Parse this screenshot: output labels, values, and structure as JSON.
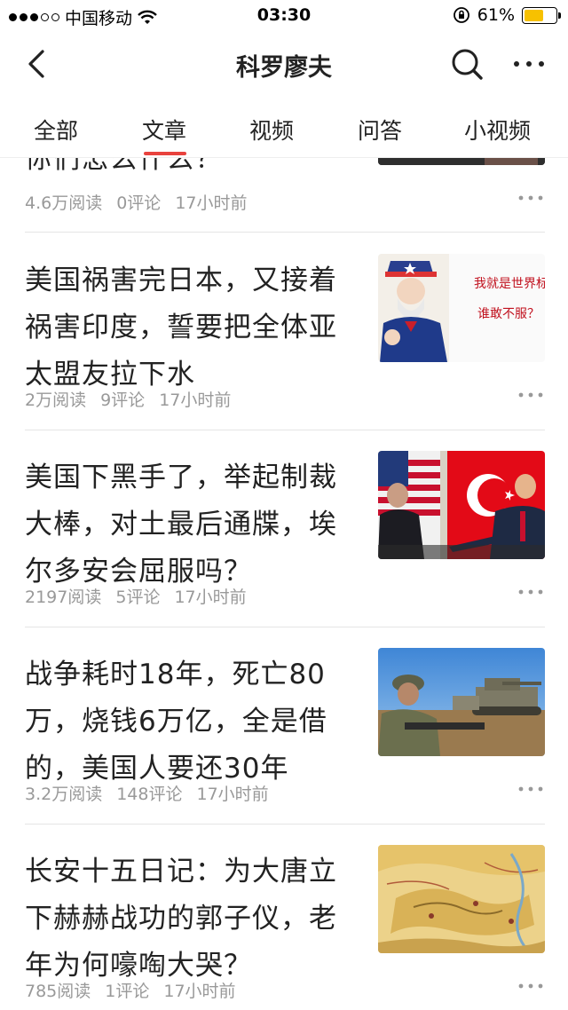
{
  "status_bar": {
    "carrier": "中国移动",
    "time": "03:30",
    "battery": "61%",
    "battery_level": 0.61,
    "icons": [
      "signal-icon",
      "wifi-icon",
      "orientation-lock-icon",
      "battery-icon"
    ]
  },
  "nav": {
    "title": "科罗廖夫",
    "icons": [
      "back-icon",
      "search-icon",
      "more-icon"
    ]
  },
  "tabs": [
    {
      "label": "全部"
    },
    {
      "label": "文章",
      "active": true
    },
    {
      "label": "视频"
    },
    {
      "label": "问答"
    },
    {
      "label": "小视频"
    }
  ],
  "colors": {
    "accent": "#e8423d",
    "meta_text": "#999999",
    "battery": "#f7c100"
  },
  "feed": {
    "partial_item": {
      "title_fragment": "你们怎么什么？",
      "reads": "4.6万阅读",
      "comments": "0评论",
      "time": "17小时前"
    },
    "articles": [
      {
        "title": "美国祸害完日本，又接着祸害印度，誓要把全体亚太盟友拉下水",
        "reads": "2万阅读",
        "comments": "9评论",
        "time": "17小时前",
        "thumb_text_1": "我就是世界标准",
        "thumb_text_2": "谁敢不服？"
      },
      {
        "title": "美国下黑手了，举起制裁大棒，对土最后通牒，埃尔多安会屈服吗？",
        "reads": "2197阅读",
        "comments": "5评论",
        "time": "17小时前"
      },
      {
        "title": "战争耗时18年，死亡80万，烧钱6万亿，全是借的，美国人要还30年",
        "reads": "3.2万阅读",
        "comments": "148评论",
        "time": "17小时前"
      },
      {
        "title": "长安十五日记：为大唐立下赫赫战功的郭子仪，老年为何嚎啕大哭？",
        "reads": "785阅读",
        "comments": "1评论",
        "time": "17小时前"
      }
    ]
  }
}
